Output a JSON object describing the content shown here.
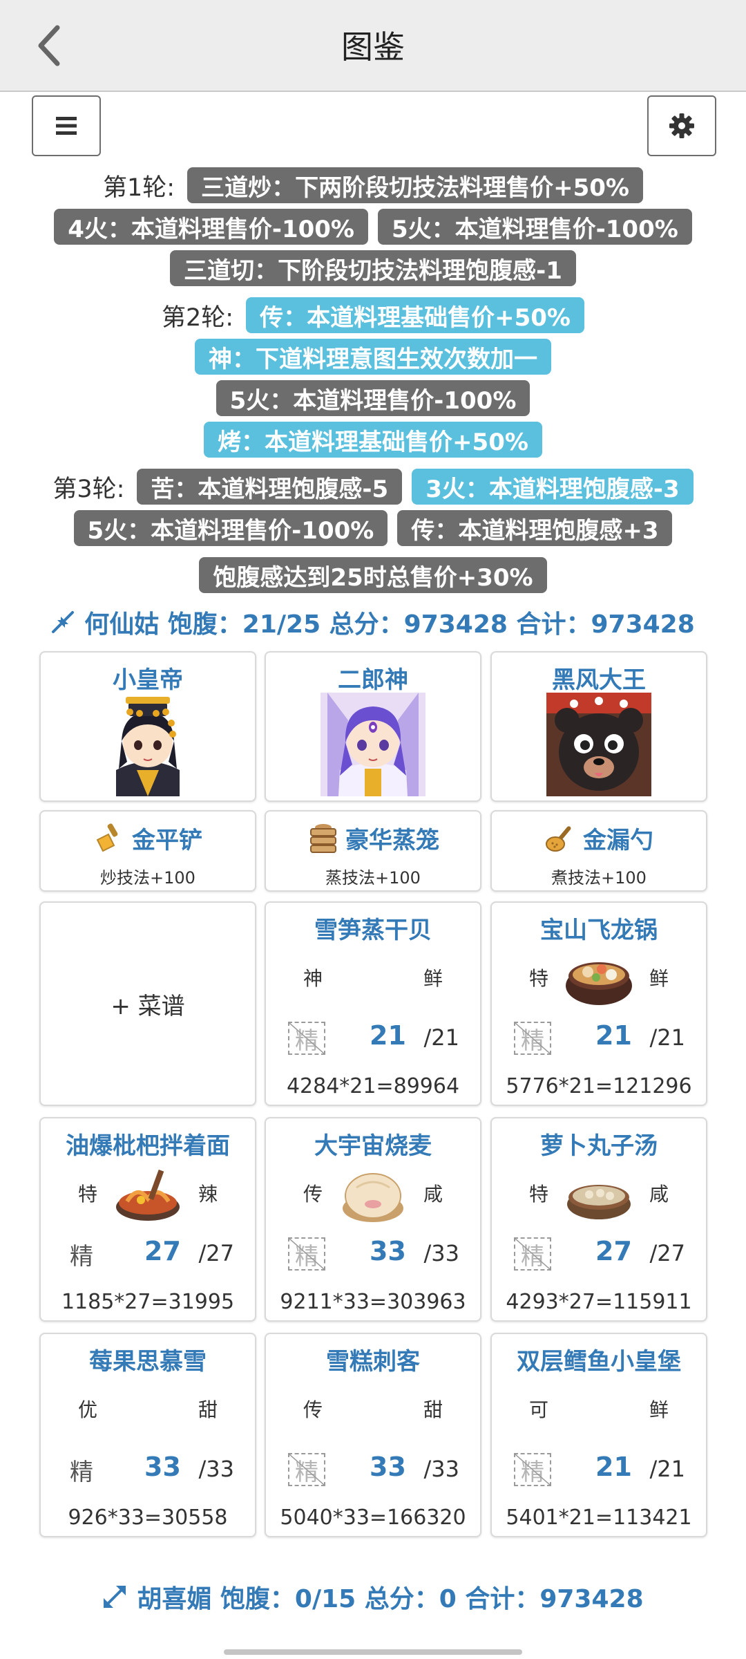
{
  "header": {
    "title": "图鉴"
  },
  "rules": {
    "lines": [
      {
        "round_label": "第1轮:",
        "pills": [
          {
            "text": "三道炒：下两阶段切技法料理售价+50%",
            "color": "gray"
          }
        ]
      },
      {
        "round_label": "",
        "pills": [
          {
            "text": "4火：本道料理售价-100%",
            "color": "gray"
          },
          {
            "text": "5火：本道料理售价-100%",
            "color": "gray"
          }
        ]
      },
      {
        "round_label": "",
        "pills": [
          {
            "text": "三道切：下阶段切技法料理饱腹感-1",
            "color": "gray"
          }
        ]
      },
      {
        "round_label": "第2轮:",
        "pills": [
          {
            "text": "传：本道料理基础售价+50%",
            "color": "blue"
          }
        ]
      },
      {
        "round_label": "",
        "pills": [
          {
            "text": "神：下道料理意图生效次数加一",
            "color": "blue"
          }
        ]
      },
      {
        "round_label": "",
        "pills": [
          {
            "text": "5火：本道料理售价-100%",
            "color": "gray"
          }
        ]
      },
      {
        "round_label": "",
        "pills": [
          {
            "text": "烤：本道料理基础售价+50%",
            "color": "blue"
          }
        ]
      },
      {
        "round_label": "第3轮:",
        "pills": [
          {
            "text": "苦：本道料理饱腹感-5",
            "color": "gray"
          },
          {
            "text": "3火：本道料理饱腹感-3",
            "color": "blue"
          }
        ]
      },
      {
        "round_label": "",
        "pills": [
          {
            "text": "5火：本道料理售价-100%",
            "color": "gray"
          },
          {
            "text": "传：本道料理饱腹感+3",
            "color": "gray"
          }
        ]
      },
      {
        "round_label": "",
        "pills": [
          {
            "text": "饱腹感达到25时总售价+30%",
            "color": "gray"
          }
        ]
      }
    ]
  },
  "player1": {
    "summary": "何仙姑 饱腹：21/25 总分：973428 合计：973428",
    "chefs": [
      {
        "name": "小皇帝",
        "portrait": "emperor-chef-portrait"
      },
      {
        "name": "二郎神",
        "portrait": "erlang-chef-portrait"
      },
      {
        "name": "黑风大王",
        "portrait": "black-bear-chef-portrait"
      }
    ],
    "equips": [
      {
        "name": "金平铲",
        "effect": "炒技法+100",
        "icon": "golden-spatula-icon"
      },
      {
        "name": "豪华蒸笼",
        "effect": "蒸技法+100",
        "icon": "steamer-icon"
      },
      {
        "name": "金漏勺",
        "effect": "煮技法+100",
        "icon": "golden-ladle-icon"
      }
    ],
    "add_recipe": "+ 菜谱",
    "dishes": [
      {
        "name": "雪笋蒸干贝",
        "rank": "神",
        "flavor": "鲜",
        "skill": "精",
        "qty": "21",
        "max": "/21",
        "formula": "4284*21=89964",
        "image": "none",
        "crossed": true
      },
      {
        "name": "宝山飞龙锅",
        "rank": "特",
        "flavor": "鲜",
        "skill": "精",
        "qty": "21",
        "max": "/21",
        "formula": "5776*21=121296",
        "image": "hotpot",
        "crossed": true
      },
      {
        "name": "油爆枇杷拌着面",
        "rank": "特",
        "flavor": "辣",
        "skill": "精",
        "qty": "27",
        "max": "/27",
        "formula": "1185*27=31995",
        "image": "noodles",
        "crossed": false
      },
      {
        "name": "大宇宙烧麦",
        "rank": "传",
        "flavor": "咸",
        "skill": "精",
        "qty": "33",
        "max": "/33",
        "formula": "9211*33=303963",
        "image": "shaomai",
        "crossed": true
      },
      {
        "name": "萝卜丸子汤",
        "rank": "特",
        "flavor": "咸",
        "skill": "精",
        "qty": "27",
        "max": "/27",
        "formula": "4293*27=115911",
        "image": "soup",
        "crossed": true
      },
      {
        "name": "莓果思慕雪",
        "rank": "优",
        "flavor": "甜",
        "skill": "精",
        "qty": "33",
        "max": "/33",
        "formula": "926*33=30558",
        "image": "none",
        "crossed": false
      },
      {
        "name": "雪糕刺客",
        "rank": "传",
        "flavor": "甜",
        "skill": "精",
        "qty": "33",
        "max": "/33",
        "formula": "5040*33=166320",
        "image": "none",
        "crossed": true
      },
      {
        "name": "双层鳕鱼小皇堡",
        "rank": "可",
        "flavor": "鲜",
        "skill": "精",
        "qty": "21",
        "max": "/21",
        "formula": "5401*21=113421",
        "image": "none",
        "crossed": true
      }
    ]
  },
  "player2": {
    "summary": "胡喜媚 饱腹：0/15 总分：0 合计：973428"
  },
  "colors": {
    "accent": "#337ab7",
    "gray_pill": "#6d6d6d",
    "blue_pill": "#5bc0de"
  }
}
